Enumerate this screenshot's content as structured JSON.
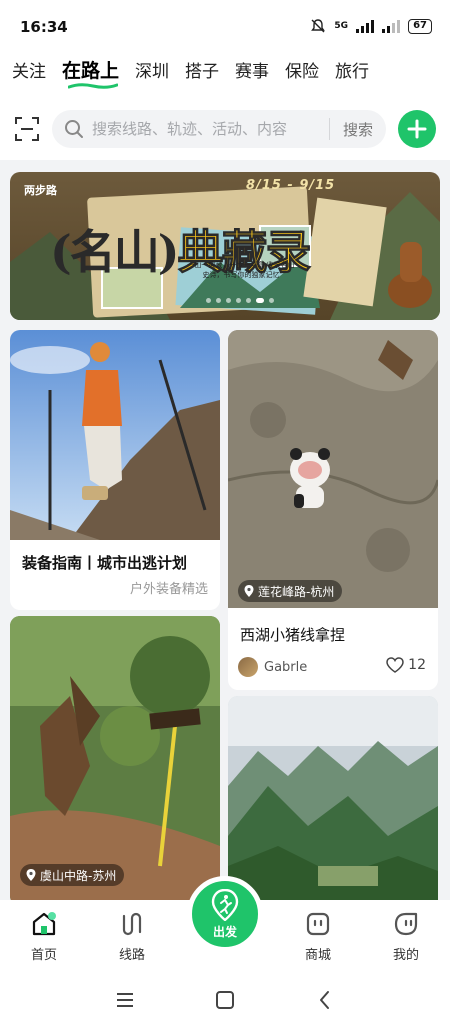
{
  "status_bar": {
    "time": "16:34",
    "network": "5G",
    "battery": "67"
  },
  "tabs": [
    {
      "label": "关注"
    },
    {
      "label": "在路上"
    },
    {
      "label": "深圳"
    },
    {
      "label": "搭子"
    },
    {
      "label": "赛事"
    },
    {
      "label": "保险"
    },
    {
      "label": "旅行"
    }
  ],
  "search": {
    "placeholder": "搜索线路、轨迹、活动、内容",
    "button": "搜索"
  },
  "banner": {
    "brand": "两步路",
    "dates": "8/15 - 9/15",
    "title_part1": "名山",
    "title_part2": "典藏录",
    "slogan": "一山一典藏，一步一华章 收录名山史诗，书写你的独家记忆"
  },
  "cards": [
    {
      "title": "装备指南丨城市出逃计划",
      "subtitle": "户外装备精选"
    },
    {
      "location": "莲花峰路-杭州",
      "title": "西湖小猪线拿捏",
      "author": "Gabrle",
      "likes": "12"
    },
    {
      "location": "虞山中路-苏州"
    },
    {}
  ],
  "bottom_nav": {
    "home": "首页",
    "routes": "线路",
    "go": "出发",
    "mall": "商城",
    "me": "我的"
  },
  "colors": {
    "accent": "#1fc46a"
  }
}
